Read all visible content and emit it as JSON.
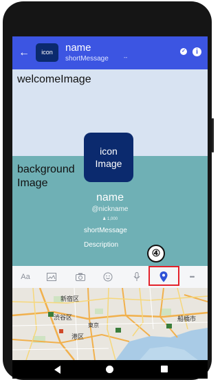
{
  "header": {
    "back_icon": "arrow-left-icon",
    "icon_label": "icon",
    "name": "name",
    "short_message": "shortMessage",
    "dash": "--",
    "color": "#3c55e2"
  },
  "welcome": {
    "label": "welcomeImage"
  },
  "background": {
    "label_line1": "background",
    "label_line2": "Image"
  },
  "profile": {
    "icon_line1": "icon",
    "icon_line2": "Image",
    "name": "name",
    "nickname": "@nickname",
    "count": "♟ 1,000",
    "short_message": "shortMessage",
    "description": "Description"
  },
  "callout": {
    "number": "④",
    "highlight_color": "#e3212a"
  },
  "toolbar": {
    "items": [
      {
        "name": "text-format-icon",
        "label": "Aa"
      },
      {
        "name": "image-icon",
        "label": "▣"
      },
      {
        "name": "camera-icon",
        "label": "◎"
      },
      {
        "name": "emoji-icon",
        "label": "☺"
      },
      {
        "name": "microphone-icon",
        "label": "♩"
      },
      {
        "name": "location-pin-icon",
        "label": ""
      },
      {
        "name": "more-icon",
        "label": "•••"
      }
    ]
  },
  "map": {
    "labels": {
      "shinjuku": "新宿区",
      "shibuya": "渋谷区",
      "tokyo": "東京",
      "minato": "港区",
      "funabashi": "船橋市"
    }
  }
}
